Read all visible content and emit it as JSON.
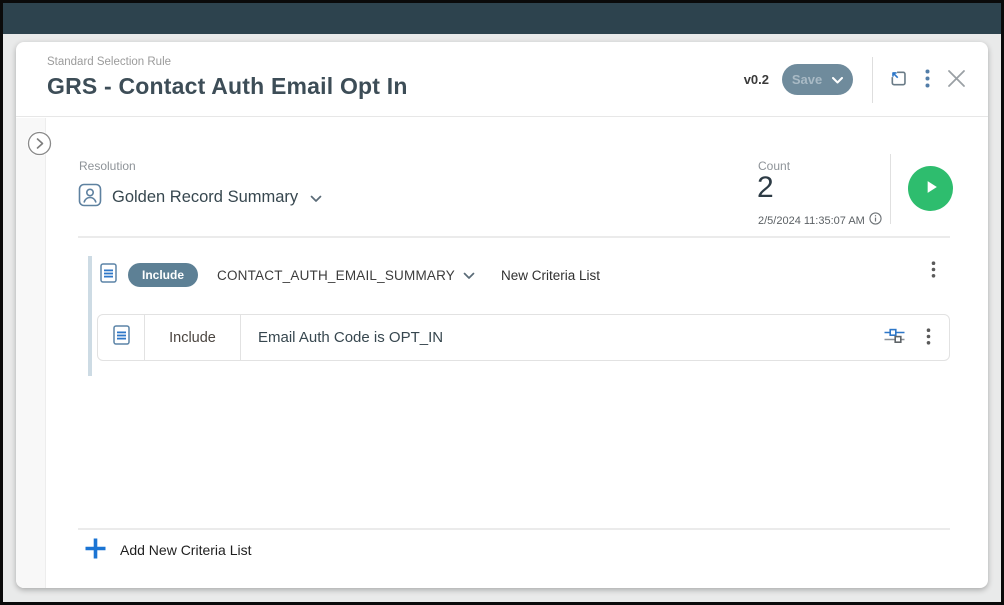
{
  "header": {
    "eyebrow": "Standard Selection Rule",
    "title": "GRS - Contact Auth Email Opt In",
    "version": "v0.2",
    "save_button": "Save"
  },
  "resolution": {
    "label": "Resolution",
    "value": "Golden Record Summary"
  },
  "count": {
    "label": "Count",
    "value": "2",
    "timestamp": "2/5/2024 11:35:07 AM"
  },
  "criteria_group": {
    "mode_badge": "Include",
    "table_name": "CONTACT_AUTH_EMAIL_SUMMARY",
    "list_name": "New Criteria List",
    "rows": [
      {
        "operator": "Include",
        "description": "Email Auth Code is OPT_IN"
      }
    ]
  },
  "actions": {
    "add_criteria_list": "Add New Criteria List"
  },
  "colors": {
    "topbar": "#2d434e",
    "accent_blue": "#2e77c8",
    "play_green": "#2ebd6e",
    "badge_slate": "#5d8095",
    "save_bg": "#6f8b9c"
  }
}
